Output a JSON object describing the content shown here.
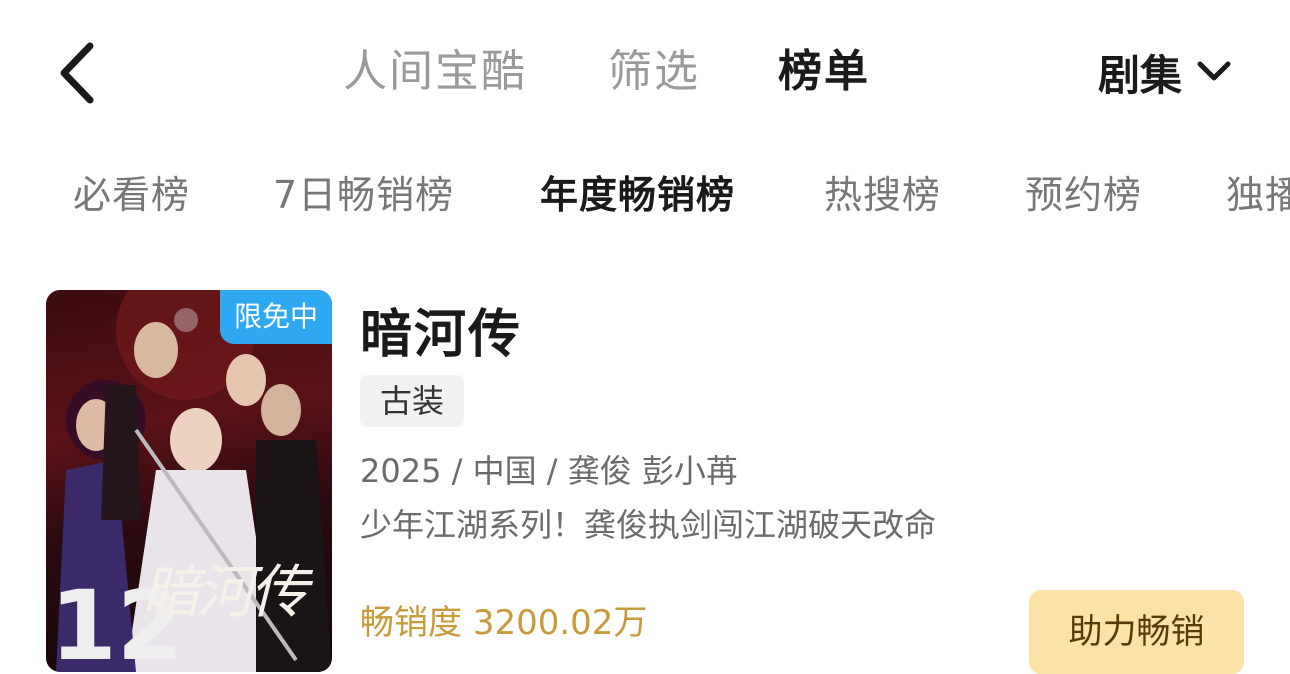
{
  "header": {
    "tabs": [
      {
        "label": "人间宝酷",
        "active": false
      },
      {
        "label": "筛选",
        "active": false
      },
      {
        "label": "榜单",
        "active": true
      }
    ],
    "type_selector": {
      "label": "剧集"
    }
  },
  "rank_tabs": [
    {
      "label": "必看榜",
      "active": false
    },
    {
      "label": "7日畅销榜",
      "active": false
    },
    {
      "label": "年度畅销榜",
      "active": true
    },
    {
      "label": "热搜榜",
      "active": false
    },
    {
      "label": "预约榜",
      "active": false
    },
    {
      "label": "独播",
      "active": false
    }
  ],
  "item": {
    "title": "暗河传",
    "badge": "限免中",
    "poster_title": "暗河传",
    "poster_number": "12",
    "tag": "古装",
    "meta": "2025 / 中国 / 龚俊 彭小苒",
    "description": "少年江湖系列！龚俊执剑闯江湖破天改命",
    "sales_label": "畅销度",
    "sales_value": "3200.02万",
    "action_label": "助力畅销"
  },
  "colors": {
    "accent_gold": "#c79a3a",
    "cta_bg": "#fbe3a7",
    "badge_blue": "#2ea8f2"
  }
}
